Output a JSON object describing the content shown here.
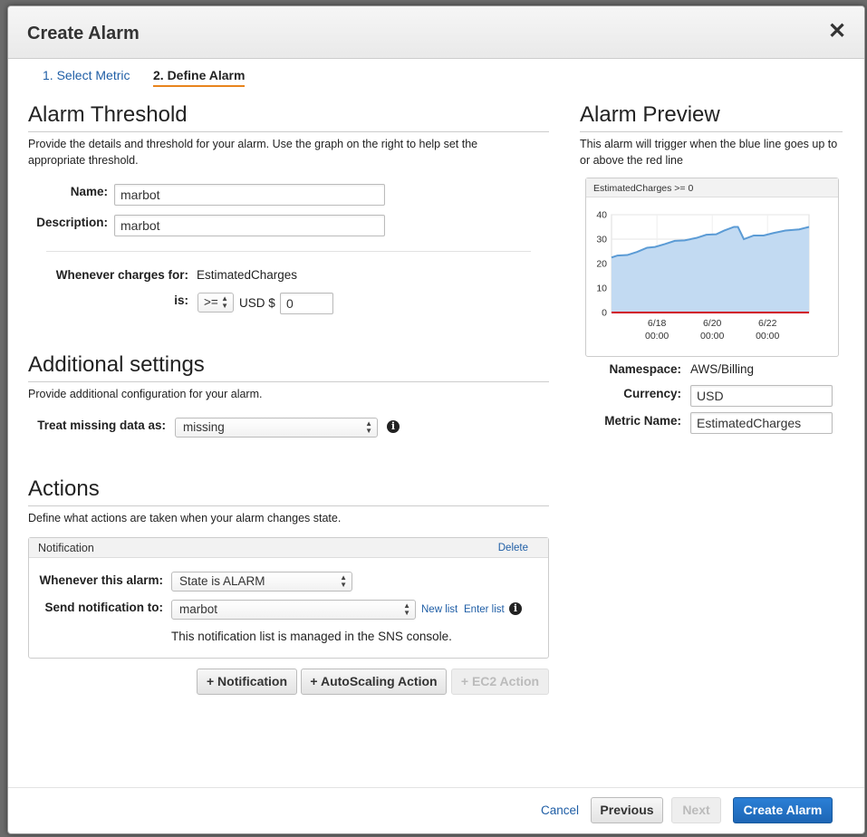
{
  "dialog": {
    "title": "Create Alarm",
    "close_glyph": "✕",
    "steps": [
      "1. Select Metric",
      "2. Define Alarm"
    ]
  },
  "threshold": {
    "heading": "Alarm Threshold",
    "description": "Provide the details and threshold for your alarm. Use the graph on the right to help set the appropriate threshold.",
    "name_label": "Name:",
    "name_value": "marbot",
    "desc_label": "Description:",
    "desc_value": "marbot",
    "whenever_label": "Whenever charges for:",
    "whenever_value": "EstimatedCharges",
    "is_label": "is:",
    "operator": ">=",
    "currency_prefix": "USD $",
    "threshold_value": "0"
  },
  "additional": {
    "heading": "Additional settings",
    "description": "Provide additional configuration for your alarm.",
    "missing_label": "Treat missing data as:",
    "missing_value": "missing"
  },
  "actions": {
    "heading": "Actions",
    "description": "Define what actions are taken when your alarm changes state.",
    "notification": {
      "title": "Notification",
      "delete_label": "Delete",
      "whenever_label": "Whenever this alarm:",
      "whenever_value": "State is ALARM",
      "send_label": "Send notification to:",
      "send_value": "marbot",
      "new_list": "New list",
      "enter_list": "Enter list",
      "managed_note": "This notification list is managed in the SNS console."
    },
    "buttons": {
      "notification": "+ Notification",
      "autoscaling": "+ AutoScaling Action",
      "ec2": "+ EC2 Action"
    }
  },
  "preview": {
    "heading": "Alarm Preview",
    "description": "This alarm will trigger when the blue line goes up to or above the red line",
    "namespace_label": "Namespace:",
    "namespace_value": "AWS/Billing",
    "currency_label": "Currency:",
    "currency_value": "USD",
    "metric_label": "Metric Name:",
    "metric_value": "EstimatedCharges"
  },
  "chart_data": {
    "type": "area",
    "title": "EstimatedCharges >= 0",
    "y_ticks": [
      "40",
      "30",
      "20",
      "10",
      "0"
    ],
    "ylim": [
      0,
      40
    ],
    "x_ticks": [
      {
        "date": "6/18",
        "time": "00:00",
        "pos": 0.23
      },
      {
        "date": "6/20",
        "time": "00:00",
        "pos": 0.51
      },
      {
        "date": "6/22",
        "time": "00:00",
        "pos": 0.79
      }
    ],
    "series": [
      {
        "x": [
          0,
          0.03,
          0.08,
          0.13,
          0.18,
          0.22,
          0.27,
          0.32,
          0.37,
          0.43,
          0.48,
          0.53,
          0.57,
          0.62,
          0.64,
          0.67,
          0.72,
          0.77,
          0.82,
          0.88,
          0.95,
          1.0
        ],
        "y": [
          22.5,
          23.3,
          23.5,
          24.8,
          26.5,
          26.8,
          28.0,
          29.3,
          29.5,
          30.5,
          31.8,
          32.0,
          33.5,
          35.0,
          35.0,
          30.0,
          31.5,
          31.5,
          32.5,
          33.5,
          34.0,
          35.0
        ]
      }
    ],
    "threshold": 0,
    "colors": {
      "line": "#5b9bd5",
      "fill": "#c2daf2",
      "threshold": "#d0021b"
    }
  },
  "footer": {
    "cancel": "Cancel",
    "previous": "Previous",
    "next": "Next",
    "create": "Create Alarm"
  }
}
